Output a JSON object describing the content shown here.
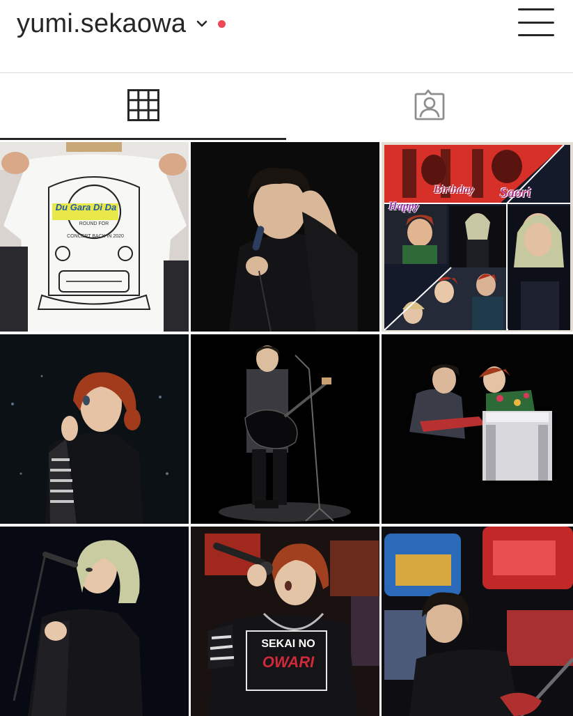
{
  "header": {
    "username": "yumi.sekaowa",
    "chevron_icon": "chevron-down-icon",
    "notification_color": "#ed4956",
    "menu_icon": "hamburger-menu-icon"
  },
  "tabs": [
    {
      "name": "grid",
      "icon": "grid-icon",
      "active": true
    },
    {
      "name": "tagged",
      "icon": "tagged-person-icon",
      "active": false
    }
  ],
  "posts": {
    "p1": {
      "shirt_brand": "Du Gara Di Da",
      "shirt_line1": "ROUND FOR",
      "shirt_line2": "CONCERT BACK IN 2020"
    },
    "p3": {
      "word1": "Happy",
      "word2": "Birthday",
      "word3": "Saori"
    },
    "p8": {
      "shirt_line1": "SEKAI NO",
      "shirt_line2": "OWARI"
    }
  },
  "colors": {
    "text": "#262626",
    "divider": "#dbdbdb",
    "accent_red": "#ed4956"
  }
}
